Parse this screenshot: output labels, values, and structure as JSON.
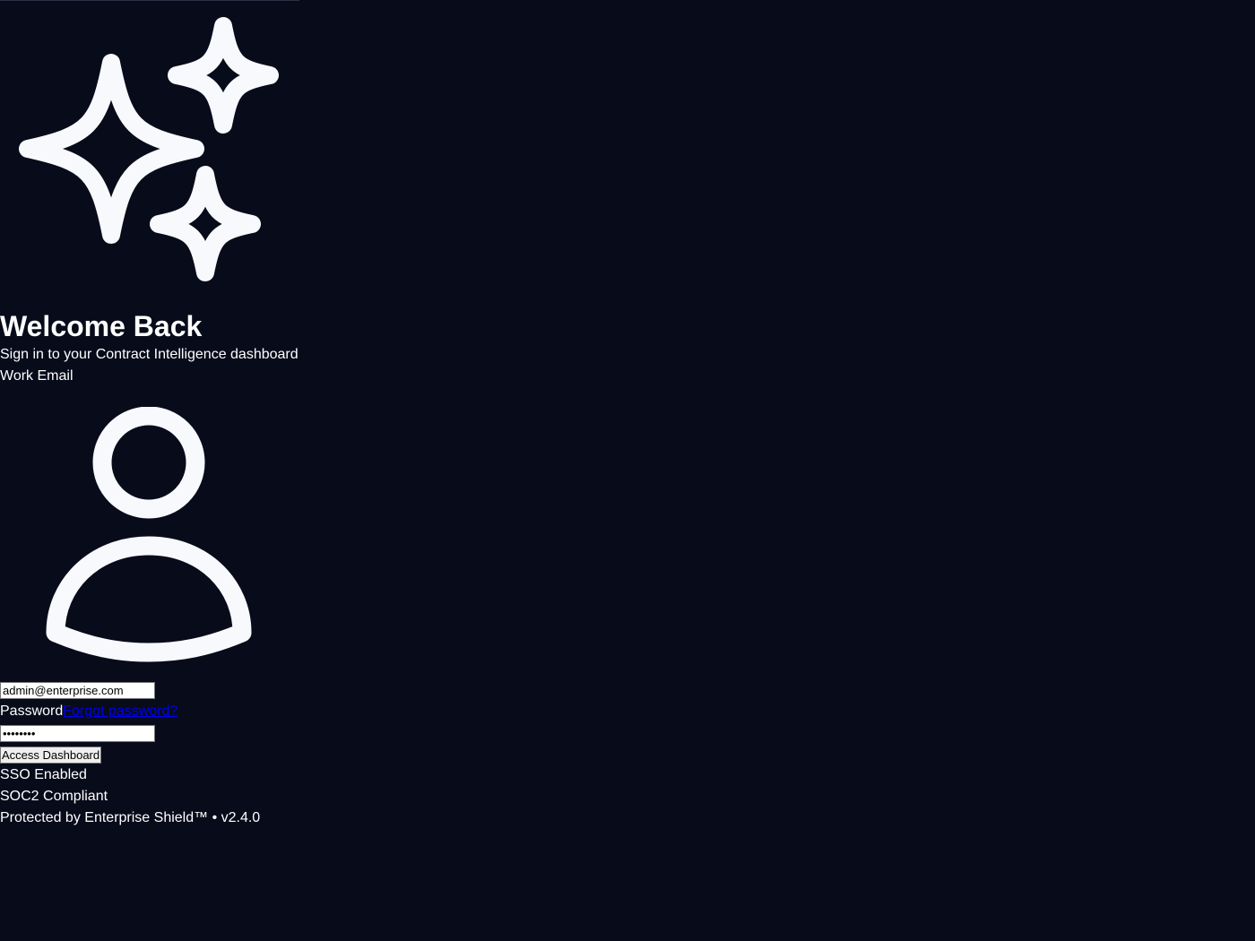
{
  "header": {
    "title": "Welcome Back",
    "subtitle": "Sign in to your Contract Intelligence dashboard"
  },
  "form": {
    "email_label": "Work Email",
    "email_value": "admin@enterprise.com",
    "password_label": "Password",
    "forgot_link": "Forgot password?",
    "password_value": "password",
    "submit_label": "Access Dashboard"
  },
  "badges": [
    "SSO Enabled",
    "SOC2 Compliant"
  ],
  "footer": {
    "text": "Protected by Enterprise Shield™ • v2.4.0"
  },
  "icons": {
    "logo": "sparkles-icon",
    "email": "user-icon"
  },
  "colors": {
    "background": "#070b1a",
    "text": "#ffffff",
    "icon": "#f8f9fc",
    "link": "#0000ee"
  }
}
